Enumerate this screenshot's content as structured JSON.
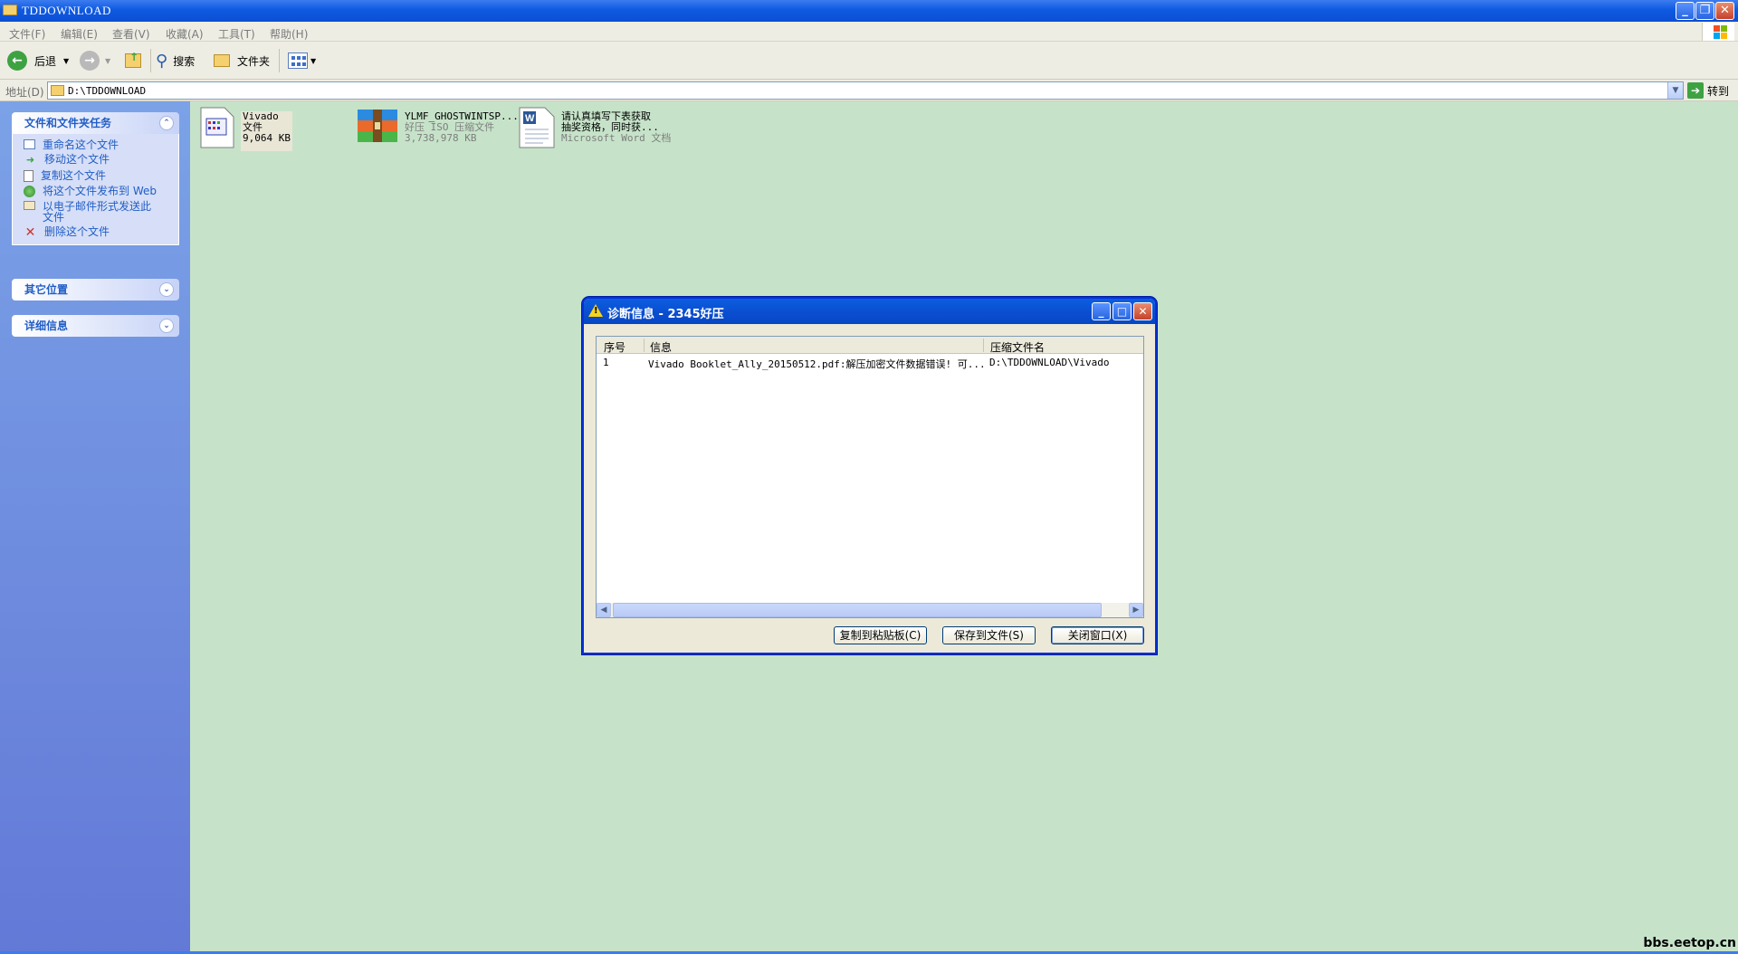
{
  "window": {
    "title": "TDDOWNLOAD"
  },
  "menu": [
    "文件(F)",
    "编辑(E)",
    "查看(V)",
    "收藏(A)",
    "工具(T)",
    "帮助(H)"
  ],
  "toolbar": {
    "back": "后退",
    "search": "搜索",
    "folders": "文件夹"
  },
  "address": {
    "label": "地址(D)",
    "value": "D:\\TDDOWNLOAD",
    "go": "转到"
  },
  "sidebar": {
    "file_tasks": {
      "title": "文件和文件夹任务",
      "items": [
        {
          "label": "重命名这个文件",
          "icon": "rename-icon"
        },
        {
          "label": "移动这个文件",
          "icon": "move-icon"
        },
        {
          "label": "复制这个文件",
          "icon": "copy-icon"
        },
        {
          "label": "将这个文件发布到 Web",
          "icon": "web-publish-icon"
        },
        {
          "label": "以电子邮件形式发送此文件",
          "icon": "email-icon"
        },
        {
          "label": "删除这个文件",
          "icon": "delete-icon"
        }
      ]
    },
    "other_places": {
      "title": "其它位置"
    },
    "details": {
      "title": "详细信息"
    }
  },
  "files": [
    {
      "name": "Vivado",
      "type": "文件",
      "size": "9,064 KB",
      "icon": "generic-file-icon"
    },
    {
      "name": "YLMF_GHOSTWINTSP...",
      "type": "好压 ISO 压缩文件",
      "size": "3,738,978 KB",
      "icon": "archive-icon"
    },
    {
      "name": "请认真填写下表获取",
      "type": "抽奖资格，同时获...",
      "size": "Microsoft Word 文档",
      "icon": "word-doc-icon"
    }
  ],
  "dialog": {
    "title": "诊断信息 - 2345好压",
    "columns": [
      "序号",
      "信息",
      "压缩文件名"
    ],
    "rows": [
      {
        "index": "1",
        "message": "Vivado Booklet_Ally_20150512.pdf:解压加密文件数据错误! 可...",
        "archive": "D:\\TDDOWNLOAD\\Vivado"
      }
    ],
    "buttons": {
      "copy": "复制到粘贴板(C)",
      "save": "保存到文件(S)",
      "close": "关闭窗口(X)"
    }
  },
  "watermark": "bbs.eetop.cn",
  "colors": {
    "desktop_bg": "#c6e3c9",
    "xp_blue": "#0b4fd2",
    "task_link": "#215dc6"
  }
}
